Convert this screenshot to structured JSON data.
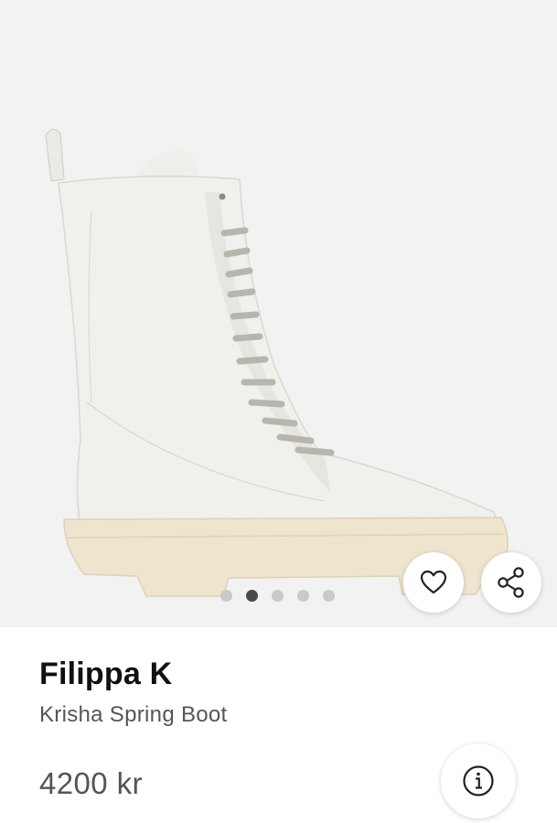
{
  "product": {
    "brand": "Filippa K",
    "name": "Krisha Spring Boot",
    "price": "4200 kr"
  },
  "gallery": {
    "image_count": 5,
    "active_index": 1
  },
  "actions": {
    "favorite_icon": "heart-icon",
    "share_icon": "share-icon",
    "info_icon": "info-icon"
  },
  "colors": {
    "hero_background": "#f2f2f2",
    "dot_active": "#4a4a4a",
    "dot_inactive": "#c9c9c9",
    "brand_text": "#111111",
    "secondary_text": "#555555"
  }
}
